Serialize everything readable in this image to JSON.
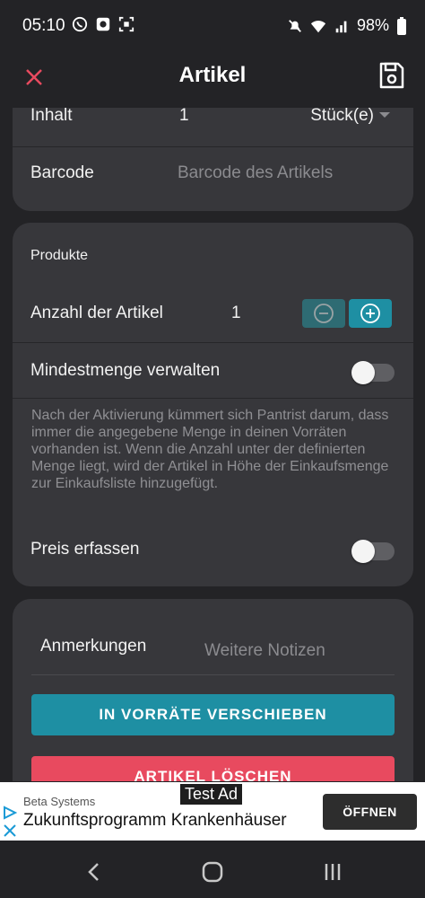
{
  "status_bar": {
    "time": "05:10",
    "battery": "98%",
    "icons": [
      "whatsapp-icon",
      "app-icon",
      "screenshot-icon",
      "mute-icon",
      "wifi-icon",
      "signal-icon",
      "battery-icon"
    ]
  },
  "app_bar": {
    "title": "Artikel",
    "close_icon": "close-icon",
    "save_icon": "save-icon",
    "accent_color": "#e84a5f"
  },
  "section_top": {
    "content_label": "Inhalt",
    "content_value": "1",
    "content_unit": "Stück(e)",
    "barcode_label": "Barcode",
    "barcode_placeholder": "Barcode des Artikels"
  },
  "section_products": {
    "header": "Produkte",
    "quantity_label": "Anzahl der Artikel",
    "quantity_value": "1",
    "min_stock_label": "Mindestmenge verwalten",
    "min_stock_enabled": false,
    "min_stock_description": "Nach der Aktivierung kümmert sich Pantrist darum, dass immer die angegebene Menge in deinen Vorräten vorhanden ist. Wenn die Anzahl unter der definierten Menge liegt, wird der Artikel in Höhe der Einkaufsmenge zur Einkaufsliste hinzugefügt.",
    "price_label": "Preis erfassen",
    "price_enabled": false
  },
  "section_notes": {
    "notes_label": "Anmerkungen",
    "notes_placeholder": "Weitere Notizen",
    "move_button": "IN VORRÄTE VERSCHIEBEN",
    "delete_button": "ARTIKEL LÖSCHEN",
    "move_color": "#1e8fa3",
    "delete_color": "#e84a5f"
  },
  "ad": {
    "badge": "Test Ad",
    "sponsor": "Beta Systems",
    "headline": "Zukunftsprogramm Krankenhäuser",
    "open_button": "ÖFFNEN"
  },
  "nav_bar": {
    "items": [
      "back-icon",
      "home-icon",
      "recents-icon"
    ]
  }
}
